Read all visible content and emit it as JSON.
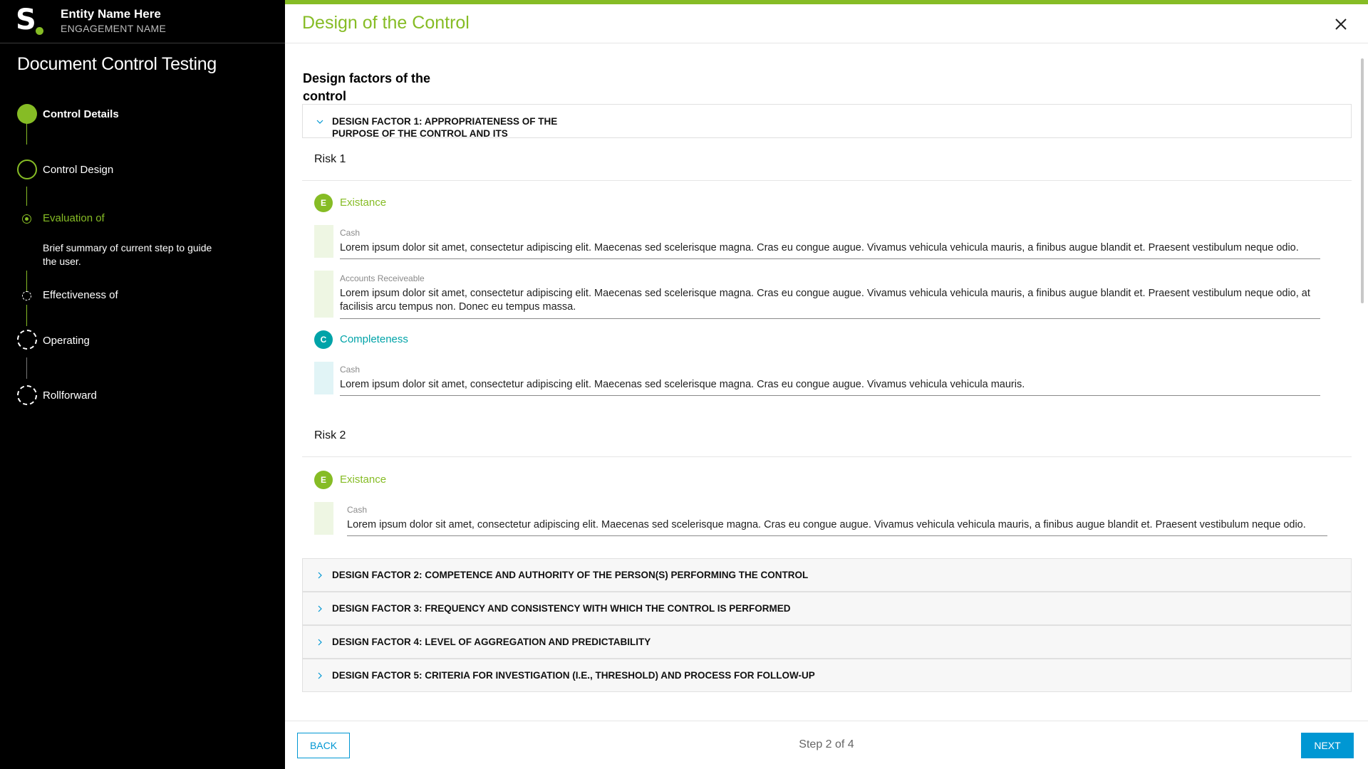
{
  "brand": {
    "logo_text": "S",
    "entity_name": "Entity Name Here",
    "engagement_name": "ENGAGEMENT NAME",
    "accent_color": "#86bc25"
  },
  "sidebar": {
    "title": "Document Control Testing",
    "steps": [
      {
        "label": "Control Details",
        "status": "done"
      },
      {
        "label": "Control Design",
        "status": "active"
      },
      {
        "label": "Evaluation of",
        "status": "current-substep",
        "summary": "Brief summary of current step to guide the user."
      },
      {
        "label": "Effectiveness of",
        "status": "pending-substep"
      },
      {
        "label": "Operating Effectiveness",
        "status": "todo"
      },
      {
        "label": "Rollforward",
        "status": "todo"
      }
    ]
  },
  "header": {
    "title": "Design of the Control",
    "close_icon": "close-icon"
  },
  "content": {
    "section_title": "Design factors of the control",
    "design_factor_1": {
      "title": "DESIGN FACTOR 1: APPROPRIATENESS OF THE PURPOSE OF THE CONTROL AND ITS",
      "expanded": true,
      "risks": [
        {
          "title": "Risk 1",
          "assertions": [
            {
              "letter": "E",
              "label": "Existance",
              "color": "#86bc25",
              "entries": [
                {
                  "label": "Cash",
                  "text": "Lorem ipsum dolor sit amet, consectetur adipiscing elit. Maecenas sed scelerisque magna. Cras eu congue augue. Vivamus vehicula vehicula mauris, a finibus augue blandit et. Praesent vestibulum neque odio."
                },
                {
                  "label": "Accounts Receiveable",
                  "text": "Lorem ipsum dolor sit amet, consectetur adipiscing elit. Maecenas sed scelerisque magna. Cras eu congue augue. Vivamus vehicula vehicula mauris, a finibus augue blandit et. Praesent vestibulum neque odio, at facilisis arcu tempus non. Donec eu tempus massa."
                }
              ]
            },
            {
              "letter": "C",
              "label": "Completeness",
              "color": "#00a3a8",
              "entries": [
                {
                  "label": "Cash",
                  "text": "Lorem ipsum dolor sit amet, consectetur adipiscing elit. Maecenas sed scelerisque magna. Cras eu congue augue. Vivamus vehicula vehicula mauris."
                }
              ]
            }
          ]
        },
        {
          "title": "Risk 2",
          "assertions": [
            {
              "letter": "E",
              "label": "Existance",
              "color": "#86bc25",
              "entries": [
                {
                  "label": "Cash",
                  "text": "Lorem ipsum dolor sit amet, consectetur adipiscing elit. Maecenas sed scelerisque magna. Cras eu congue augue. Vivamus vehicula vehicula mauris, a finibus augue blandit et. Praesent vestibulum neque odio."
                }
              ]
            }
          ]
        }
      ]
    },
    "collapsed_factors": [
      "DESIGN FACTOR 2: COMPETENCE AND AUTHORITY OF THE PERSON(S) PERFORMING THE CONTROL",
      "DESIGN FACTOR 3: FREQUENCY AND CONSISTENCY WITH WHICH THE CONTROL IS PERFORMED",
      "DESIGN FACTOR 4: LEVEL OF AGGREGATION AND PREDICTABILITY",
      "DESIGN FACTOR 5: CRITERIA FOR INVESTIGATION (I.E., THRESHOLD) AND PROCESS FOR FOLLOW-UP"
    ]
  },
  "footer": {
    "back_label": "BACK",
    "step_text": "Step 2 of 4",
    "next_label": "NEXT",
    "button_color": "#0097d3"
  }
}
